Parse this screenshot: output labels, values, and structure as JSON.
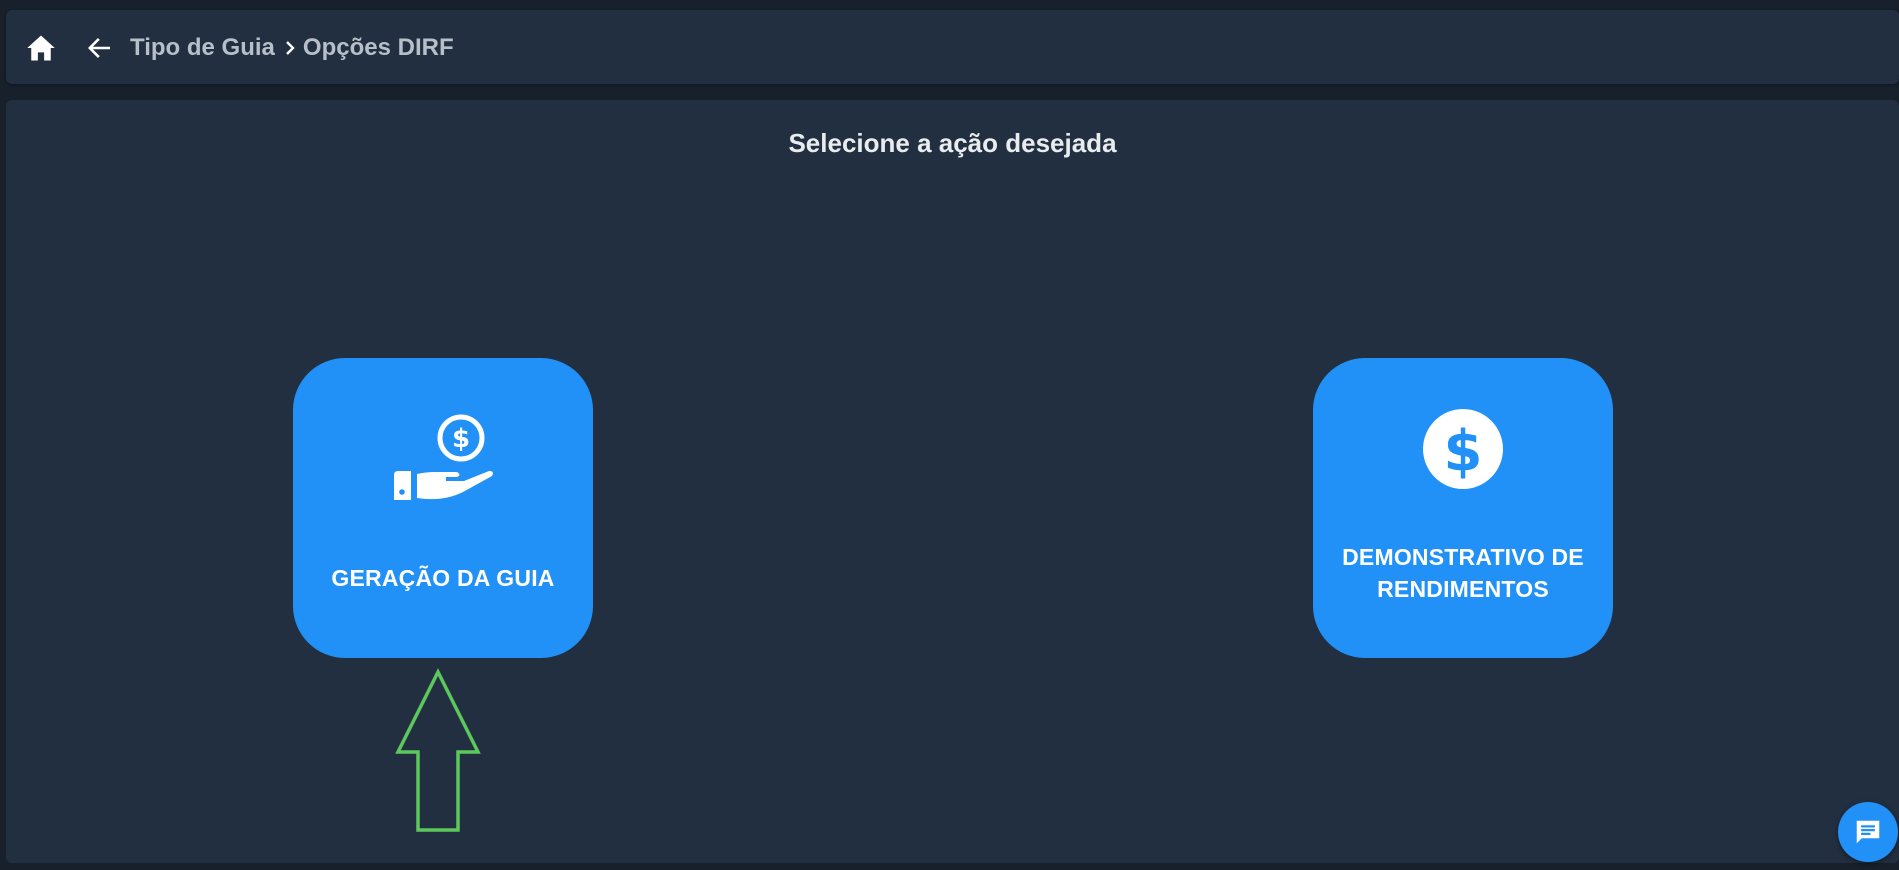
{
  "header": {
    "home_icon": "home-icon",
    "back_icon": "arrow-left-icon",
    "breadcrumb": {
      "parent": "Tipo de Guia",
      "separator_icon": "chevron-right-icon",
      "current": "Opções DIRF"
    }
  },
  "main": {
    "title": "Selecione a ação desejada",
    "actions": [
      {
        "icon": "hand-coin-icon",
        "label": "GERAÇÃO DA GUIA"
      },
      {
        "icon": "dollar-circle-icon",
        "label": "DEMONSTRATIVO DE RENDIMENTOS"
      }
    ]
  },
  "annotation": {
    "icon": "arrow-up-outline-icon",
    "color": "#5cc85c"
  },
  "chat": {
    "icon": "chat-icon"
  },
  "colors": {
    "background": "#17202b",
    "panel": "#222f40",
    "accent": "#2191f7",
    "text": "#e9ecef",
    "breadcrumb_text": "#b7bfc9"
  }
}
